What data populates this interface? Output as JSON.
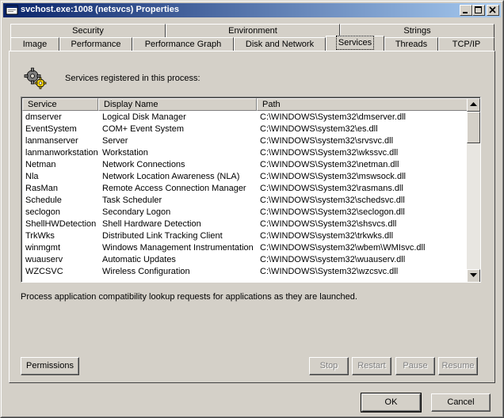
{
  "window": {
    "title": "svchost.exe:1008 (netsvcs) Properties"
  },
  "tabs_top": [
    {
      "label": "Security"
    },
    {
      "label": "Environment"
    },
    {
      "label": "Strings"
    }
  ],
  "tabs_bottom": [
    {
      "label": "Image"
    },
    {
      "label": "Performance"
    },
    {
      "label": "Performance Graph"
    },
    {
      "label": "Disk and Network"
    },
    {
      "label": "Services",
      "active": true
    },
    {
      "label": "Threads"
    },
    {
      "label": "TCP/IP"
    }
  ],
  "services": {
    "header_text": "Services registered in this process:",
    "columns": [
      "Service",
      "Display Name",
      "Path"
    ],
    "rows": [
      [
        "dmserver",
        "Logical Disk Manager",
        "C:\\WINDOWS\\System32\\dmserver.dll"
      ],
      [
        "EventSystem",
        "COM+ Event System",
        "C:\\WINDOWS\\system32\\es.dll"
      ],
      [
        "lanmanserver",
        "Server",
        "C:\\WINDOWS\\system32\\srvsvc.dll"
      ],
      [
        "lanmanworkstation",
        "Workstation",
        "C:\\WINDOWS\\System32\\wkssvc.dll"
      ],
      [
        "Netman",
        "Network Connections",
        "C:\\WINDOWS\\System32\\netman.dll"
      ],
      [
        "Nla",
        "Network Location Awareness (NLA)",
        "C:\\WINDOWS\\System32\\mswsock.dll"
      ],
      [
        "RasMan",
        "Remote Access Connection Manager",
        "C:\\WINDOWS\\System32\\rasmans.dll"
      ],
      [
        "Schedule",
        "Task Scheduler",
        "C:\\WINDOWS\\system32\\schedsvc.dll"
      ],
      [
        "seclogon",
        "Secondary Logon",
        "C:\\WINDOWS\\System32\\seclogon.dll"
      ],
      [
        "ShellHWDetection",
        "Shell Hardware Detection",
        "C:\\WINDOWS\\System32\\shsvcs.dll"
      ],
      [
        "TrkWks",
        "Distributed Link Tracking Client",
        "C:\\WINDOWS\\system32\\trkwks.dll"
      ],
      [
        "winmgmt",
        "Windows Management Instrumentation",
        "C:\\WINDOWS\\system32\\wbem\\WMIsvc.dll"
      ],
      [
        "wuauserv",
        "Automatic Updates",
        "C:\\WINDOWS\\system32\\wuauserv.dll"
      ],
      [
        "WZCSVC",
        "Wireless Configuration",
        "C:\\WINDOWS\\System32\\wzcsvc.dll"
      ]
    ],
    "description": "Process application compatibility lookup requests for applications as they are launched."
  },
  "buttons": {
    "permissions": "Permissions",
    "stop": "Stop",
    "restart": "Restart",
    "pause": "Pause",
    "resume": "Resume",
    "ok": "OK",
    "cancel": "Cancel"
  }
}
